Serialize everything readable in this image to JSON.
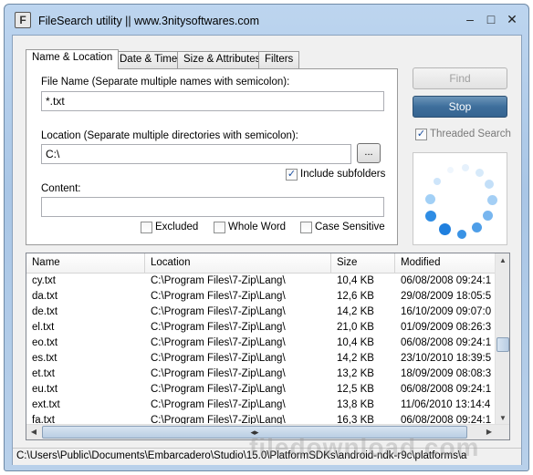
{
  "window": {
    "title": "FileSearch utility || www.3nitysoftwares.com",
    "icon": "app-icon"
  },
  "tabs": [
    {
      "label": "Name & Location",
      "active": true
    },
    {
      "label": "Date & Time",
      "active": false
    },
    {
      "label": "Size & Attributes",
      "active": false
    },
    {
      "label": "Filters",
      "active": false
    }
  ],
  "form": {
    "file_name_label": "File Name (Separate multiple names with semicolon):",
    "file_name_value": "*.txt",
    "location_label": "Location (Separate multiple directories with semicolon):",
    "location_value": "C:\\",
    "browse_label": "...",
    "include_subfolders_label": "Include subfolders",
    "include_subfolders_checked": true,
    "content_label": "Content:",
    "content_value": "",
    "excluded_label": "Excluded",
    "whole_word_label": "Whole Word",
    "case_sensitive_label": "Case Sensitive"
  },
  "actions": {
    "find_label": "Find",
    "stop_label": "Stop",
    "threaded_search_label": "Threaded Search",
    "threaded_search_checked": true
  },
  "results": {
    "columns": [
      "Name",
      "Location",
      "Size",
      "Modified"
    ],
    "rows": [
      {
        "name": "cy.txt",
        "location": "C:\\Program Files\\7-Zip\\Lang\\",
        "size": "10,4 KB",
        "modified": "06/08/2008 09:24:1"
      },
      {
        "name": "da.txt",
        "location": "C:\\Program Files\\7-Zip\\Lang\\",
        "size": "12,6 KB",
        "modified": "29/08/2009 18:05:5"
      },
      {
        "name": "de.txt",
        "location": "C:\\Program Files\\7-Zip\\Lang\\",
        "size": "14,2 KB",
        "modified": "16/10/2009 09:07:0"
      },
      {
        "name": "el.txt",
        "location": "C:\\Program Files\\7-Zip\\Lang\\",
        "size": "21,0 KB",
        "modified": "01/09/2009 08:26:3"
      },
      {
        "name": "eo.txt",
        "location": "C:\\Program Files\\7-Zip\\Lang\\",
        "size": "10,4 KB",
        "modified": "06/08/2008 09:24:1"
      },
      {
        "name": "es.txt",
        "location": "C:\\Program Files\\7-Zip\\Lang\\",
        "size": "14,2 KB",
        "modified": "23/10/2010 18:39:5"
      },
      {
        "name": "et.txt",
        "location": "C:\\Program Files\\7-Zip\\Lang\\",
        "size": "13,2 KB",
        "modified": "18/09/2009 08:08:3"
      },
      {
        "name": "eu.txt",
        "location": "C:\\Program Files\\7-Zip\\Lang\\",
        "size": "12,5 KB",
        "modified": "06/08/2008 09:24:1"
      },
      {
        "name": "ext.txt",
        "location": "C:\\Program Files\\7-Zip\\Lang\\",
        "size": "13,8 KB",
        "modified": "11/06/2010 13:14:4"
      },
      {
        "name": "fa.txt",
        "location": "C:\\Program Files\\7-Zip\\Lang\\",
        "size": "16,3 KB",
        "modified": "06/08/2008 09:24:1"
      }
    ]
  },
  "statusbar": {
    "text": "C:\\Users\\Public\\Documents\\Embarcadero\\Studio\\15.0\\PlatformSDKs\\android-ndk-r9c\\platforms\\a"
  },
  "watermark": "filedownload.com",
  "colors": {
    "stop_button": "#3e6f9c",
    "spinner_dot": "#2f8de4",
    "selection_accent": "#1a4fa0"
  }
}
